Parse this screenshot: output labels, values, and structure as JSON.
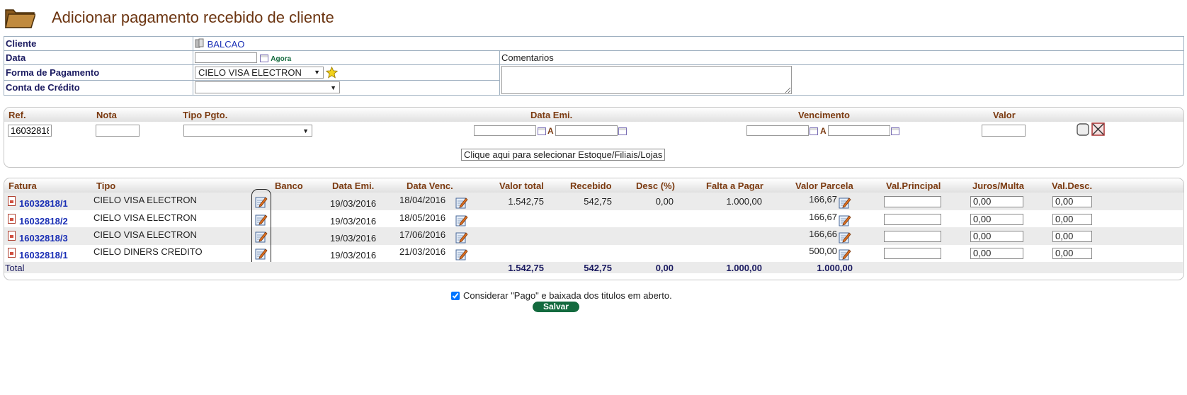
{
  "page": {
    "title": "Adicionar pagamento recebido de cliente"
  },
  "form": {
    "cliente_label": "Cliente",
    "cliente_value": "BALCAO",
    "data_label": "Data",
    "data_value": "",
    "agora_label": "Agora",
    "comentarios_label": "Comentarios",
    "comentarios_value": "",
    "forma_label": "Forma de Pagamento",
    "forma_value": "CIELO VISA ELECTRON",
    "conta_label": "Conta de Crédito",
    "conta_value": ""
  },
  "filter": {
    "headers": {
      "ref": "Ref.",
      "nota": "Nota",
      "tipo": "Tipo Pgto.",
      "data_emi": "Data Emi.",
      "vencimento": "Vencimento",
      "valor": "Valor"
    },
    "ref_value": "16032818",
    "nota_value": "",
    "tipo_value": "",
    "range_sep_1": "A",
    "range_sep_2": "A",
    "select_button": "Clique aqui para selecionar Estoque/Filiais/Lojas"
  },
  "payments": {
    "headers": {
      "fatura": "Fatura",
      "tipo": "Tipo",
      "banco": "Banco",
      "data_emi": "Data Emi.",
      "data_venc": "Data Venc.",
      "valor_total": "Valor total",
      "recebido": "Recebido",
      "desc": "Desc (%)",
      "falta": "Falta a Pagar",
      "parcela": "Valor Parcela",
      "principal": "Val.Principal",
      "juros": "Juros/Multa",
      "valdesc": "Val.Desc."
    },
    "rows": [
      {
        "fatura": "16032818/1",
        "tipo": "CIELO VISA ELECTRON",
        "banco": "",
        "data_emi": "19/03/2016",
        "data_venc": "18/04/2016",
        "valor_total": "1.542,75",
        "recebido": "542,75",
        "desc": "0,00",
        "falta": "1.000,00",
        "parcela": "166,67",
        "principal": "",
        "juros": "0,00",
        "valdesc": "0,00"
      },
      {
        "fatura": "16032818/2",
        "tipo": "CIELO VISA ELECTRON",
        "banco": "",
        "data_emi": "19/03/2016",
        "data_venc": "18/05/2016",
        "valor_total": "",
        "recebido": "",
        "desc": "",
        "falta": "",
        "parcela": "166,67",
        "principal": "",
        "juros": "0,00",
        "valdesc": "0,00"
      },
      {
        "fatura": "16032818/3",
        "tipo": "CIELO VISA ELECTRON",
        "banco": "",
        "data_emi": "19/03/2016",
        "data_venc": "17/06/2016",
        "valor_total": "",
        "recebido": "",
        "desc": "",
        "falta": "",
        "parcela": "166,66",
        "principal": "",
        "juros": "0,00",
        "valdesc": "0,00"
      },
      {
        "fatura": "16032818/1",
        "tipo": "CIELO DINERS CREDITO",
        "banco": "",
        "data_emi": "19/03/2016",
        "data_venc": "21/03/2016",
        "valor_total": "",
        "recebido": "",
        "desc": "",
        "falta": "",
        "parcela": "500,00",
        "principal": "",
        "juros": "0,00",
        "valdesc": "0,00"
      }
    ],
    "total": {
      "label": "Total",
      "valor_total": "1.542,75",
      "recebido": "542,75",
      "desc": "0,00",
      "falta": "1.000,00",
      "parcela": "1.000,00"
    }
  },
  "footer": {
    "checkbox_label": "Considerar \"Pago\" e baixada dos titulos em aberto.",
    "checkbox_checked": true,
    "save_label": "Salvar"
  },
  "colors": {
    "title": "#6b3410",
    "header": "#7b3a10",
    "link": "#1a2fb5",
    "save": "#136a3e"
  },
  "icons": [
    "folder-icon",
    "client-icon",
    "calendar-icon",
    "star-icon",
    "document-icon",
    "edit-icon",
    "clear-icon",
    "delete-icon"
  ]
}
